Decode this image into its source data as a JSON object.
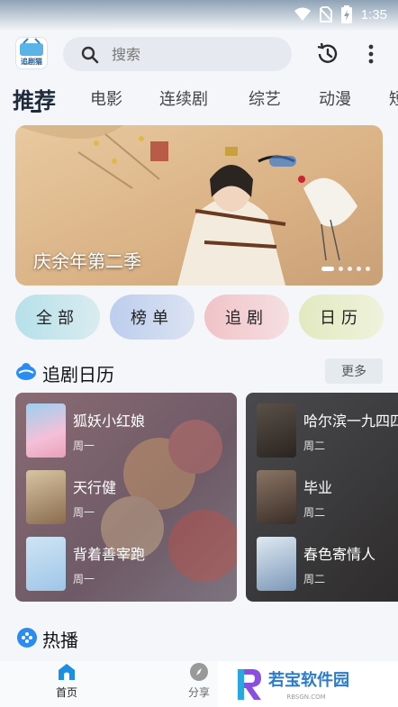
{
  "status": {
    "time": "1:35"
  },
  "app": {
    "logo_text": "追剧猫"
  },
  "search": {
    "placeholder": "搜索"
  },
  "tabs": [
    {
      "label": "推荐"
    },
    {
      "label": "电影"
    },
    {
      "label": "连续剧"
    },
    {
      "label": "综艺"
    },
    {
      "label": "动漫"
    },
    {
      "label": "短"
    }
  ],
  "banner": {
    "title": "庆余年第二季",
    "dots": 5,
    "active_dot": 0
  },
  "quick": [
    {
      "label": "全部",
      "color": "#bfe3ea"
    },
    {
      "label": "榜单",
      "color": "#c8d6f0"
    },
    {
      "label": "追剧",
      "color": "#f2cfd3"
    },
    {
      "label": "日历",
      "color": "#e6ecc8"
    }
  ],
  "calendar": {
    "title": "追剧日历",
    "more": "更多",
    "days": [
      {
        "items": [
          {
            "name": "狐妖小红娘",
            "day": "周一"
          },
          {
            "name": "天行健",
            "day": "周一"
          },
          {
            "name": "背着善宰跑",
            "day": "周一"
          }
        ]
      },
      {
        "items": [
          {
            "name": "哈尔滨一九四四",
            "day": "周二"
          },
          {
            "name": "毕业",
            "day": "周二"
          },
          {
            "name": "春色寄情人",
            "day": "周二"
          }
        ]
      }
    ]
  },
  "hot": {
    "title": "热播"
  },
  "nav": [
    {
      "label": "首页",
      "active": true
    },
    {
      "label": "分享",
      "active": false
    }
  ],
  "watermark": {
    "title": "若宝软件园",
    "sub": "RBSGN.COM"
  },
  "colors": {
    "accent": "#2a8cf0",
    "nav_active": "#1e8fe0"
  }
}
